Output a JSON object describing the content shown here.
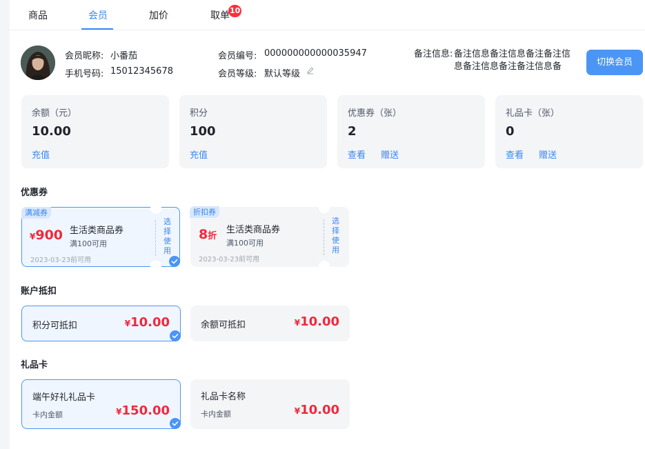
{
  "tabs": [
    {
      "label": "商品"
    },
    {
      "label": "会员"
    },
    {
      "label": "加价"
    },
    {
      "label": "取单",
      "badge": "10"
    }
  ],
  "member": {
    "nickname_label": "会员昵称:",
    "nickname": "小番茄",
    "phone_label": "手机号码:",
    "phone": "15012345678",
    "id_label": "会员编号:",
    "id": "000000000000035947",
    "level_label": "会员等级:",
    "level": "默认等级",
    "note_label": "备注信息:",
    "note_line1": "备注信息备注信息备注备注信",
    "note_line2": "息备注信息备注备注信息备",
    "switch_button": "切换会员"
  },
  "stats": [
    {
      "title": "余额（元）",
      "value": "10.00",
      "actions": [
        "充值"
      ]
    },
    {
      "title": "积分",
      "value": "100",
      "actions": [
        "充值"
      ]
    },
    {
      "title": "优惠券（张）",
      "value": "2",
      "actions": [
        "查看",
        "赠送"
      ]
    },
    {
      "title": "礼品卡（张）",
      "value": "0",
      "actions": [
        "查看",
        "赠送"
      ]
    }
  ],
  "coupons_section": {
    "title": "优惠券",
    "items": [
      {
        "tag": "满减券",
        "currency": "¥",
        "amount": "900",
        "name": "生活类商品券",
        "condition": "满100可用",
        "date": "2023-03-23前可用",
        "action": "选择使用",
        "selected": true
      },
      {
        "tag": "折扣券",
        "amount": "8",
        "unit": "折",
        "name": "生活类商品券",
        "condition": "满100可用",
        "date": "2023-03-23前可用",
        "action": "选择使用",
        "selected": false
      }
    ]
  },
  "deduct_section": {
    "title": "账户抵扣",
    "items": [
      {
        "label": "积分可抵扣",
        "currency": "¥",
        "amount": "10.00",
        "selected": true
      },
      {
        "label": "余额可抵扣",
        "currency": "¥",
        "amount": "10.00",
        "selected": false
      }
    ]
  },
  "giftcard_section": {
    "title": "礼品卡",
    "items": [
      {
        "name": "端午好礼礼品卡",
        "sub": "卡内金额",
        "currency": "¥",
        "amount": "150.00",
        "selected": true
      },
      {
        "name": "礼品卡名称",
        "sub": "卡内金额",
        "currency": "¥",
        "amount": "10.00",
        "selected": false
      }
    ]
  },
  "colors": {
    "accent": "#3a86f0",
    "price_red": "#f0283c",
    "card_bg": "#f4f5f7"
  }
}
